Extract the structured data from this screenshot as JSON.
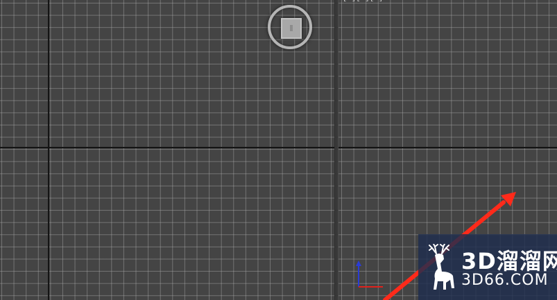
{
  "viewports": {
    "right_label": "[+][  ][          ]"
  },
  "cursor": {
    "icon": "move-cursor-icon"
  },
  "annotation": {
    "arrow_color": "#ff2a1a",
    "icon": "red-arrow-icon"
  },
  "gizmo": {
    "icon": "axis-tripod-icon",
    "x_color": "#e0221c",
    "y_color": "#2a3cd6"
  },
  "watermark": {
    "brand": "3D溜溜网",
    "url": "3D66.COM",
    "logo_icon": "deer-icon",
    "background": "#1e2d4e"
  }
}
